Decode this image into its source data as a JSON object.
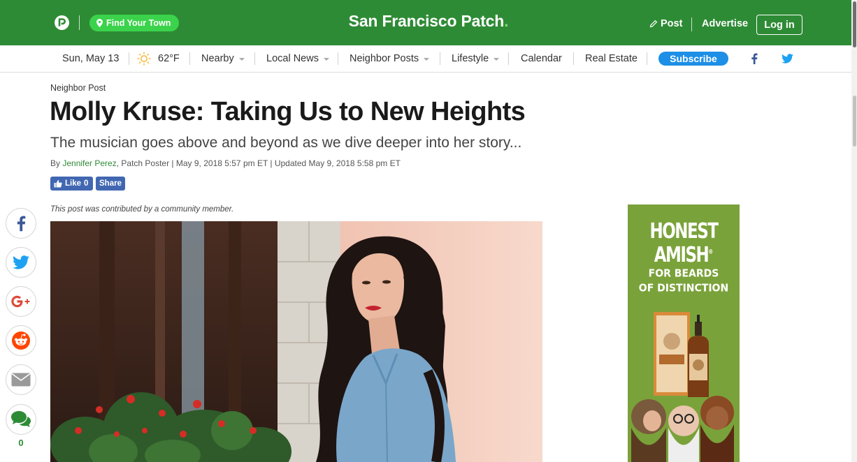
{
  "topbar": {
    "find_town": "Find Your Town",
    "site_title": "San Francisco Patch",
    "site_title_dot": ".",
    "post": "Post",
    "advertise": "Advertise",
    "login": "Log in",
    "brand_color": "#2e8b35"
  },
  "subnav": {
    "date": "Sun, May 13",
    "weather_icon": "sun-icon",
    "temperature": "62°F",
    "nearby": "Nearby",
    "local_news": "Local News",
    "neighbor_posts": "Neighbor Posts",
    "lifestyle": "Lifestyle",
    "calendar": "Calendar",
    "real_estate": "Real Estate",
    "subscribe": "Subscribe"
  },
  "article": {
    "kicker": "Neighbor Post",
    "headline": "Molly Kruse: Taking Us to New Heights",
    "subhead": "The musician goes above and beyond as we dive deeper into her story...",
    "byline_prefix": "By ",
    "author": "Jennifer Perez",
    "byline_rest": ", Patch Poster | May 9, 2018 5:57 pm ET | Updated May 9, 2018 5:58 pm ET",
    "like_label": "Like",
    "like_count": "0",
    "share_label": "Share",
    "contrib_note": "This post was contributed by a community member."
  },
  "share_rail": {
    "icons": [
      "facebook-icon",
      "twitter-icon",
      "google-plus-icon",
      "reddit-icon",
      "email-icon",
      "comment-icon"
    ],
    "comment_count": "0"
  },
  "ad": {
    "brand": "HONEST AMISH",
    "trademark": "®",
    "tagline_line1": "FOR BEARDS",
    "tagline_line2": "OF DISTINCTION",
    "background": "#7aa23a"
  }
}
